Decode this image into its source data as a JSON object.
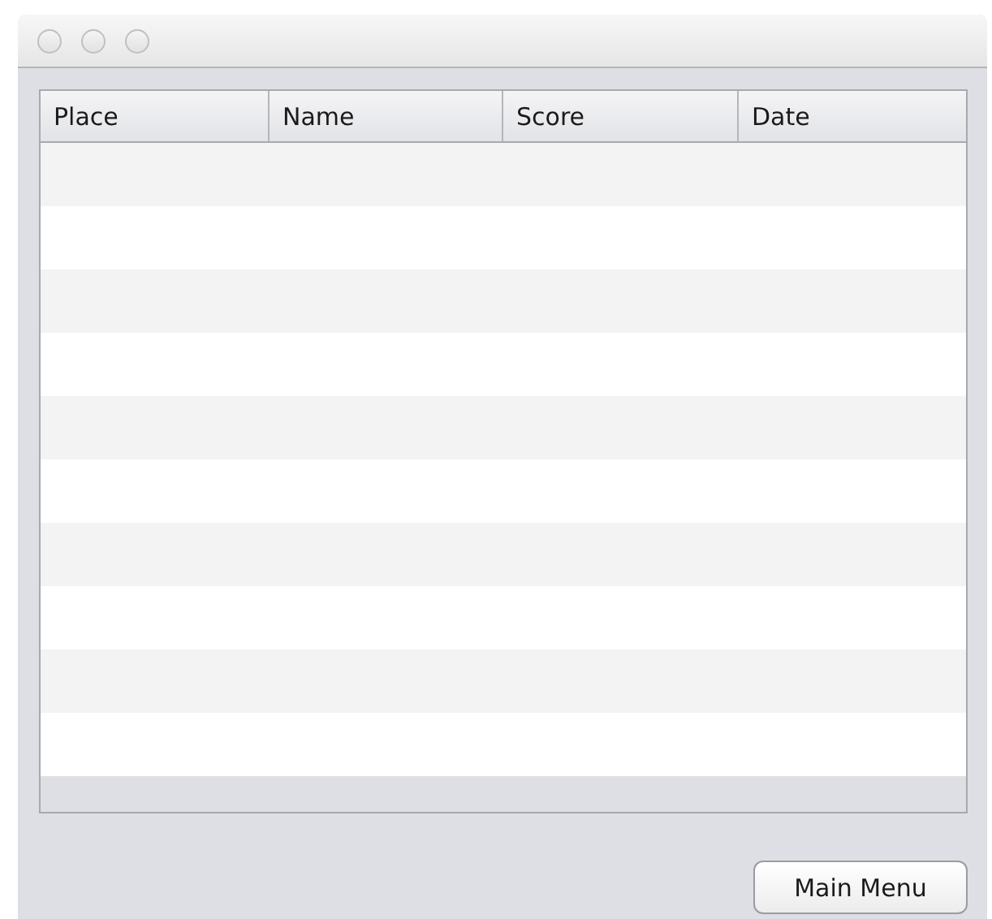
{
  "table": {
    "columns": [
      "Place",
      "Name",
      "Score",
      "Date"
    ]
  },
  "buttons": [
    "Main Menu"
  ]
}
